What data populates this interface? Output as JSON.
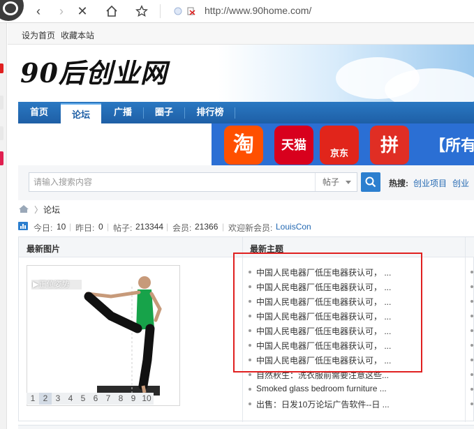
{
  "browser": {
    "url": "http://www.90home.com/"
  },
  "site_topbar": {
    "set_home": "设为首页",
    "bookmark": "收藏本站"
  },
  "header": {
    "logo_text": "90后创业网"
  },
  "nav": {
    "items": [
      {
        "label": "首页"
      },
      {
        "label": "论坛"
      },
      {
        "label": "广播"
      },
      {
        "label": "圈子"
      },
      {
        "label": "排行榜"
      }
    ],
    "active_index": 1
  },
  "ad_banner": {
    "tiles": [
      {
        "label": "淘",
        "color": "#ff5000"
      },
      {
        "label": "天猫",
        "color": "#d8001d"
      },
      {
        "label": "京东",
        "color": "#e1251b"
      },
      {
        "label": "拼",
        "color": "#e02e24"
      }
    ],
    "headline": "【所有"
  },
  "search": {
    "placeholder": "请输入搜索内容",
    "type_value": "帖子",
    "hot_label": "热搜:",
    "hot_links": [
      "创业项目",
      "创业"
    ]
  },
  "breadcrumb": {
    "current": "论坛"
  },
  "stats": {
    "today_label": "今日:",
    "today": "10",
    "yesterday_label": "昨日:",
    "yesterday": "0",
    "posts_label": "帖子:",
    "posts": "213344",
    "members_label": "会员:",
    "members": "21366",
    "welcome_label": "欢迎新会员:",
    "new_member": "LouisCon"
  },
  "panel": {
    "latest_images_title": "最新图片",
    "latest_topics_title": "最新主题",
    "photo_tag": "▶正位姿势",
    "pager": [
      "1",
      "2",
      "3",
      "4",
      "5",
      "6",
      "7",
      "8",
      "9",
      "10"
    ],
    "pager_active": "2",
    "topics": [
      "中国人民电器厂低压电器获认可，   ...",
      "中国人民电器厂低压电器获认可，   ...",
      "中国人民电器厂低压电器获认可，   ...",
      "中国人民电器厂低压电器获认可，   ...",
      "中国人民电器厂低压电器获认可，   ...",
      "中国人民电器厂低压电器获认可，   ...",
      "中国人民电器厂低压电器获认可，   ...",
      "自然秋生：洗衣服前需要注意这些...",
      "Smoked glass bedroom furniture ...",
      "出售：日发10万论坛广告软件--日 ..."
    ]
  }
}
